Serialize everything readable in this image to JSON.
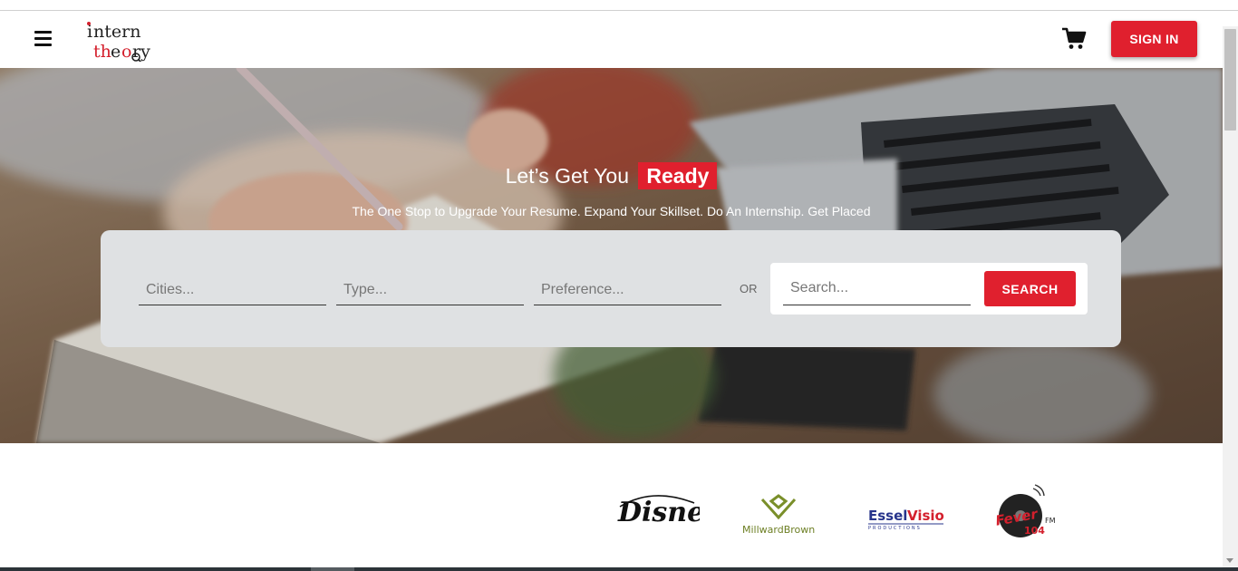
{
  "header": {
    "logo_text": "intern theory",
    "sign_in_label": "SIGN IN"
  },
  "hero": {
    "title": "Let’s Get You",
    "title_accent": "Ready",
    "subtitle": "The One Stop to Upgrade Your Resume. Expand Your Skillset. Do An Internship. Get Placed",
    "filters": {
      "cities_placeholder": "Cities...",
      "type_placeholder": "Type...",
      "preference_placeholder": "Preference..."
    },
    "or_label": "OR",
    "search": {
      "placeholder": "Search...",
      "button_label": "SEARCH"
    }
  },
  "clients": [
    {
      "name": "Disney"
    },
    {
      "name": "MillwardBrown"
    },
    {
      "name": "EsselVision"
    },
    {
      "name": "Fever 104 FM"
    }
  ],
  "colors": {
    "brand_red": "#e0202e",
    "panel_gray": "#dfe1e3"
  },
  "icons": [
    "hamburger-menu-icon",
    "cart-icon"
  ]
}
